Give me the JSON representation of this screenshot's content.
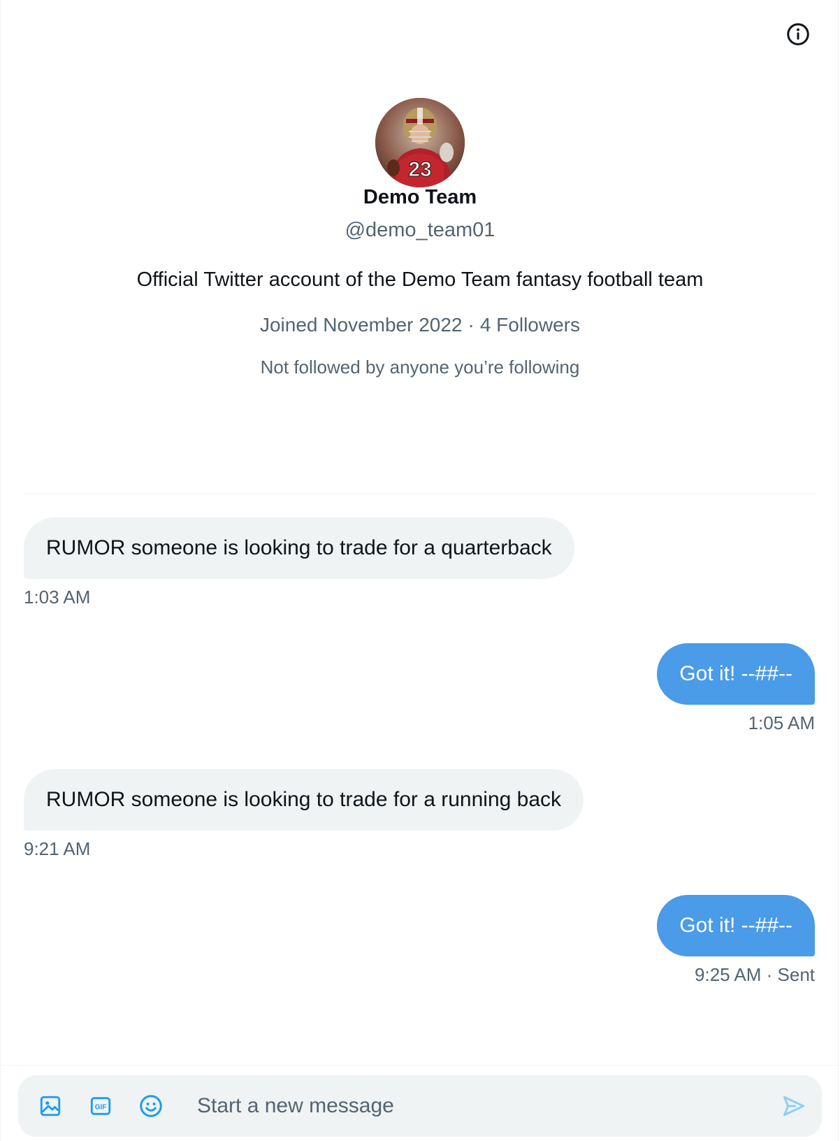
{
  "profile": {
    "name": "Demo Team",
    "handle": "@demo_team01",
    "bio": "Official Twitter account of the Demo Team fantasy football team",
    "joined": "Joined November 2022",
    "separator": "·",
    "followers": "4 Followers",
    "followed_by": "Not followed by anyone you’re following"
  },
  "messages": [
    {
      "direction": "incoming",
      "text": "RUMOR someone is looking to trade for a quarterback",
      "time": "1:03 AM"
    },
    {
      "direction": "outgoing",
      "text": "Got it! --##--",
      "time": "1:05 AM"
    },
    {
      "direction": "incoming",
      "text": "RUMOR someone is looking to trade for a running back",
      "time": "9:21 AM"
    },
    {
      "direction": "outgoing",
      "text": "Got it! --##--",
      "time": "9:25 AM · Sent"
    }
  ],
  "composer": {
    "placeholder": "Start a new message",
    "icons": [
      "image-icon",
      "gif-icon",
      "emoji-icon",
      "send-icon"
    ]
  },
  "header": {
    "icons": [
      "info-icon"
    ]
  },
  "colors": {
    "accent": "#1d9bf0",
    "outgoing_bubble": "#4a9be8",
    "incoming_bubble": "#eff3f4",
    "secondary_text": "#536471"
  }
}
